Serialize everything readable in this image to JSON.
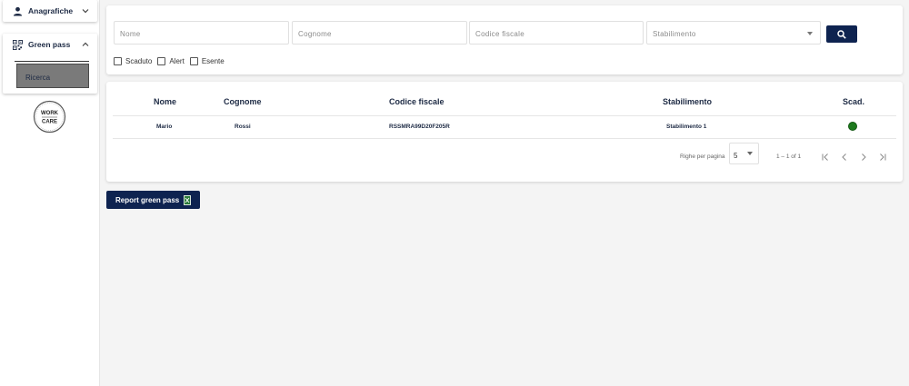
{
  "sidebar": {
    "anagrafiche": {
      "label": "Anagrafiche",
      "icon": "person-icon"
    },
    "green_pass": {
      "label": "Green pass",
      "icon": "qr-code-icon",
      "items": [
        {
          "label": "Ricerca"
        }
      ]
    },
    "logo": {
      "line1": "WORK",
      "line2": "CARE"
    }
  },
  "search": {
    "nome_placeholder": "Nome",
    "cognome_placeholder": "Cognome",
    "codice_fiscale_placeholder": "Codice fiscale",
    "stabilimento_placeholder": "Stabilimento",
    "filters": [
      {
        "label": "Scaduto"
      },
      {
        "label": "Alert"
      },
      {
        "label": "Esente"
      }
    ]
  },
  "table": {
    "headers": {
      "nome": "Nome",
      "cognome": "Cognome",
      "codice_fiscale": "Codice fiscale",
      "stabilimento": "Stabilimento",
      "scad": "Scad."
    },
    "rows": [
      {
        "nome": "Mario",
        "cognome": "Rossi",
        "codice_fiscale": "RSSMRA99D20F205R",
        "stabilimento": "Stabilimento 1",
        "status_color": "#1e7a1e"
      }
    ],
    "pagination": {
      "rows_per_page_label": "Righe per pagina",
      "rows_per_page": "5",
      "range": "1 – 1 of 1"
    }
  },
  "report_button": {
    "label": "Report green pass",
    "icon": "excel-icon"
  },
  "colors": {
    "primary": "#0e2350",
    "status_ok": "#1e7a1e"
  }
}
